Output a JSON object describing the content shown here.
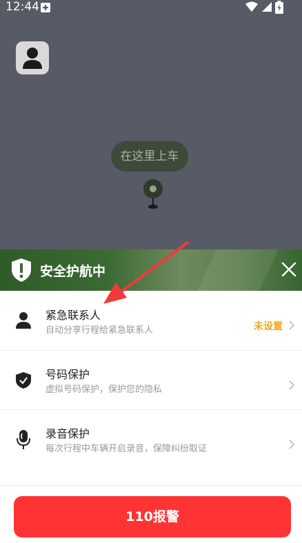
{
  "status_bar": {
    "time": "12:44"
  },
  "map": {
    "pickup_label": "在这里上车"
  },
  "safety_panel": {
    "title": "安全护航中",
    "items": [
      {
        "title": "紧急联系人",
        "subtitle": "自动分享行程给紧急联系人",
        "status": "未设置",
        "icon": "person-icon"
      },
      {
        "title": "号码保护",
        "subtitle": "虚拟号码保护，保护您的隐私",
        "icon": "shield-check-icon"
      },
      {
        "title": "录音保护",
        "subtitle": "每次行程中车辆开启录音，保障纠纷取证",
        "icon": "microphone-icon"
      }
    ]
  },
  "alarm_button": {
    "label": "110报警"
  },
  "colors": {
    "accent_red": "#ff3333",
    "status_orange": "#f0a81c",
    "banner_green": "#3b6a33"
  }
}
